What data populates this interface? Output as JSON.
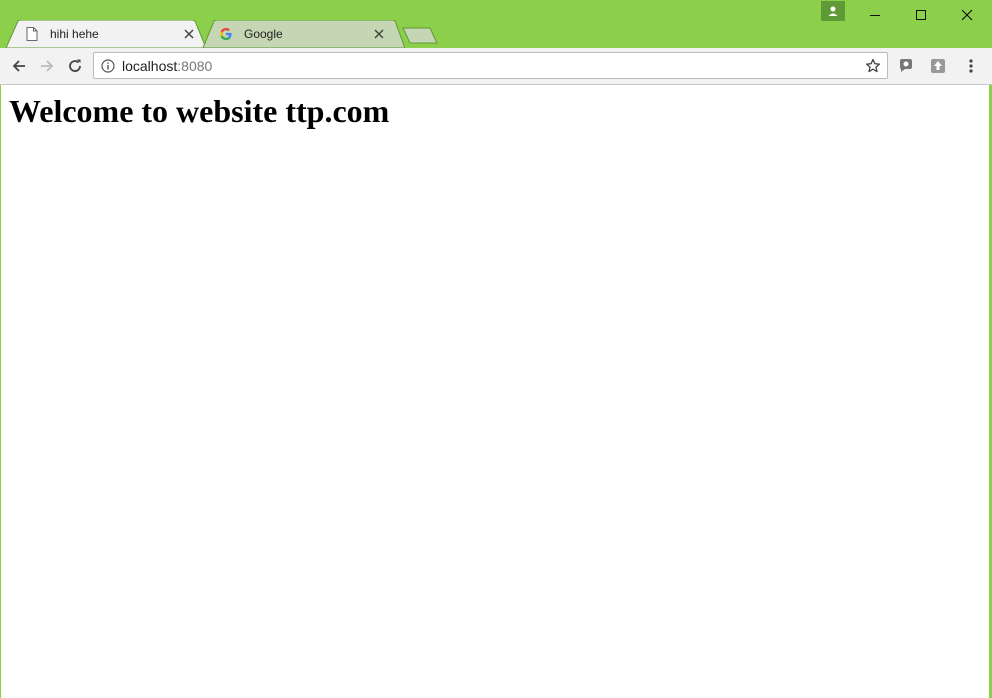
{
  "browser": {
    "accent": "#8bcf4a",
    "tabs": [
      {
        "title": "hihi hehe",
        "icon": "page-icon",
        "active": true
      },
      {
        "title": "Google",
        "icon": "google-icon",
        "active": false
      }
    ],
    "address": {
      "host": "localhost",
      "port": ":8080"
    },
    "icons": {
      "back": "back-arrow-icon",
      "forward": "forward-arrow-icon",
      "reload": "reload-icon",
      "info": "info-icon",
      "bookmark": "star-icon",
      "menu": "kebab-menu-icon"
    }
  },
  "page": {
    "heading": "Welcome to website ttp.com"
  }
}
